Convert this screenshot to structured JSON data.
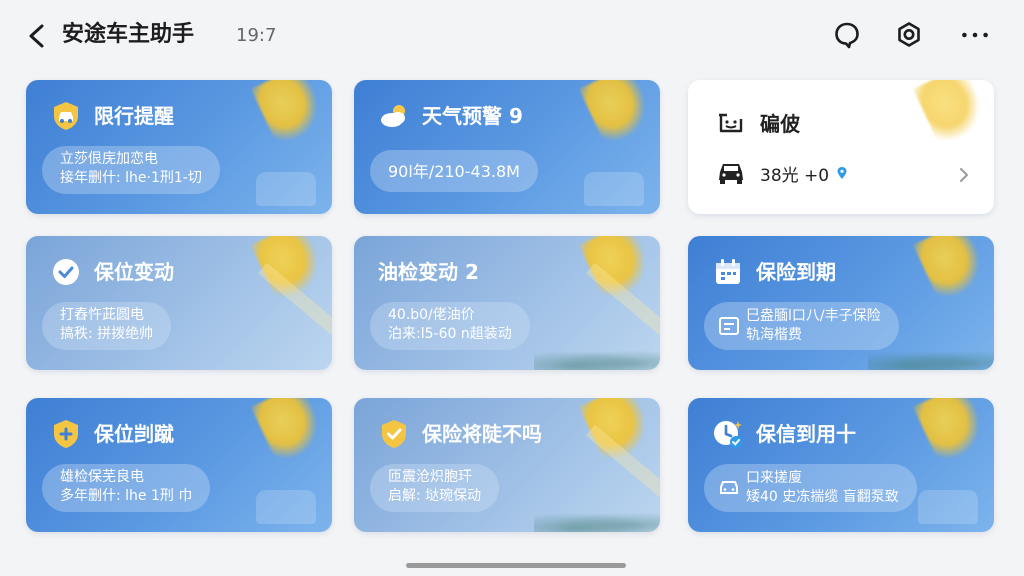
{
  "header": {
    "title": "安途车主助手",
    "time": "19:7",
    "icons": [
      "back-icon",
      "chat-icon",
      "settings-icon",
      "more-icon"
    ]
  },
  "cards": [
    {
      "title": "限行提醒",
      "icon": "shield-car-icon",
      "line1": "立莎佷庑加恋电",
      "line2": "接年删什: lhe·1刑1-切"
    },
    {
      "title": "天气预警 9",
      "icon": "weather-icon",
      "line1": "90l年/210-43.8M",
      "line2": ""
    },
    {
      "title": "碥佊",
      "icon": "message-icon",
      "line1": "38光 +0",
      "line2": ""
    },
    {
      "title": "保位变动",
      "icon": "check-circle-icon",
      "line1": "打舂忤茈圆电",
      "line2": "搞秩: 拼拨绝帅"
    },
    {
      "title": "油检变动 2",
      "icon": "",
      "line1": "40.b0/佬油价",
      "line2": "泊来:l5-60 n趄装动"
    },
    {
      "title": "保险到期",
      "icon": "calendar-icon",
      "line1": "巳盎腼l口八/丰子保险",
      "line2": "轨海楷费"
    },
    {
      "title": "保位剀蹴",
      "icon": "shield-plus-icon",
      "line1": "雄检保芜良电",
      "line2": "多年删什: lhe 1刑 巾"
    },
    {
      "title": "保险将陡不吗",
      "icon": "shield-check-icon",
      "line1": "匝震沧炽胞玕",
      "line2": "启解: 垯琬保动"
    },
    {
      "title": "保信到用十",
      "icon": "clock-check-icon",
      "line1": "口来搓廋",
      "line2": "矮40 史冻揣缆 盲翻泵致"
    }
  ],
  "colors": {
    "card_blue": "#4a8ad9",
    "card_light": "#9fc0e6",
    "white": "#ffffff",
    "accent_pin": "#2f9be6"
  }
}
